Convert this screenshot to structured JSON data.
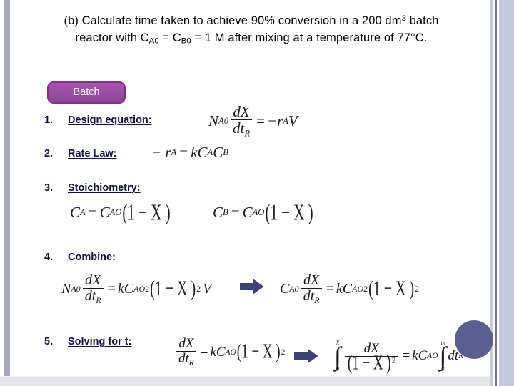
{
  "slide": {
    "title_prefix": "(b) Calculate time taken to achieve 90% conversion in a 200 dm",
    "title_sup": "3",
    "title_mid": " batch",
    "title_line2_a": "reactor with C",
    "title_sub_a": "A0",
    "title_line2_b": " = C",
    "title_sub_b": "B0",
    "title_line2_c": " = 1 M after mixing at a temperature of 77°C.",
    "badge_label": "Batch"
  },
  "steps": [
    {
      "num": "1.",
      "label": "Design equation:"
    },
    {
      "num": "2.",
      "label": "Rate Law:"
    },
    {
      "num": "3.",
      "label": "Stoichiometry:"
    },
    {
      "num": "4.",
      "label": "Combine:"
    },
    {
      "num": "5.",
      "label": "Solving for t:"
    }
  ],
  "equations": {
    "design": {
      "lhs_var": "N",
      "lhs_sub": "A0",
      "frac_num": "dX",
      "frac_den": "dt",
      "frac_den_sub": "R",
      "eq": "=",
      "rhs": "−r",
      "rhs_sub": "A",
      "rhs_tail": "V"
    },
    "rate_law": {
      "lhs": "− r",
      "lhs_sub": "A",
      "eq": "=",
      "rhs_k": "k",
      "rhs_c1": "C",
      "rhs_c1_sub": "A",
      "rhs_c2": "C",
      "rhs_c2_sub": "B"
    },
    "stoich_a": {
      "lhs": "C",
      "lhs_sub": "A",
      "eq": "=",
      "rhs": "C",
      "rhs_sub": "AO",
      "expr": "(1 − X )"
    },
    "stoich_b": {
      "lhs": "C",
      "lhs_sub": "B",
      "eq": "=",
      "rhs": "C",
      "rhs_sub": "AO",
      "expr": "(1 − X )"
    },
    "combine_1": {
      "lhs_var": "N",
      "lhs_sub": "A0",
      "frac_num": "dX",
      "frac_den": "dt",
      "frac_den_sub": "R",
      "eq": "=",
      "rhs_k": "k",
      "rhs_c": "C",
      "rhs_c_sub": "AO",
      "rhs_c_sup": "2",
      "rhs_paren": "(1 − X )",
      "rhs_paren_sup": "2",
      "rhs_tail": "V"
    },
    "combine_2": {
      "lhs_var": "C",
      "lhs_sub": "A0",
      "frac_num": "dX",
      "frac_den": "dt",
      "frac_den_sub": "R",
      "eq": "=",
      "rhs_k": "k",
      "rhs_c": "C",
      "rhs_c_sub": "AO",
      "rhs_c_sup": "2",
      "rhs_paren": "(1 − X )",
      "rhs_paren_sup": "2"
    },
    "solve_1": {
      "frac_num": "dX",
      "frac_den": "dt",
      "frac_den_sub": "R",
      "eq": "=",
      "rhs_k": "k",
      "rhs_c": "C",
      "rhs_c_sub": "AO",
      "rhs_paren": "(1 − X )",
      "rhs_paren_sup": "2"
    },
    "solve_2": {
      "int1_upper": "X",
      "int1_lower": "0",
      "int1_sym": "∫",
      "frac_num": "dX",
      "frac_den": "(1 − X )",
      "frac_den_sup": "2",
      "eq": "=",
      "rhs_k": "k",
      "rhs_c": "C",
      "rhs_c_sub": "AO",
      "int2_upper": "t",
      "int2_upper_sub": "R",
      "int2_lower": "0",
      "int2_sym": "∫",
      "rhs_diff": "dt",
      "rhs_diff_sub": "R"
    }
  },
  "icons": {
    "arrow_1": "right-block-arrow",
    "arrow_2": "right-block-arrow",
    "circle": "decorative-circle"
  },
  "colors": {
    "badge_fill": "#9b4ea6",
    "badge_border": "#7b3384",
    "arrow": "#3d4273",
    "circle": "#5a5f8f",
    "edge_band": "#c6c8dd",
    "edge_left": "#a6a9bd",
    "text": "#10103a"
  }
}
